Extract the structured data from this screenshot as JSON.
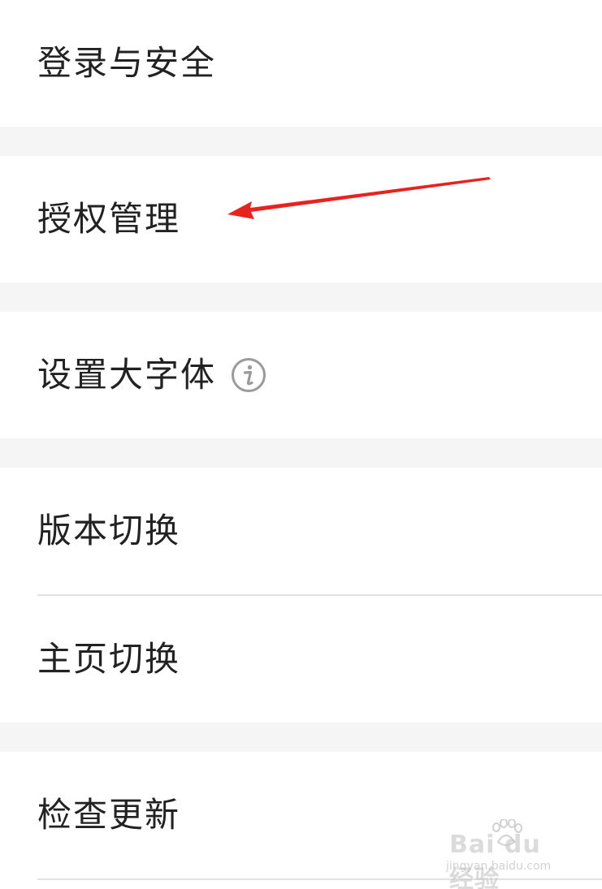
{
  "settings": {
    "items": [
      {
        "label": "登录与安全"
      },
      {
        "label": "授权管理"
      },
      {
        "label": "设置大字体"
      },
      {
        "label": "版本切换"
      },
      {
        "label": "主页切换"
      },
      {
        "label": "检查更新"
      }
    ]
  },
  "icons": {
    "info": "info-icon",
    "annotation": "red-arrow-icon"
  },
  "colors": {
    "background": "#f5f5f5",
    "row": "#ffffff",
    "text": "#222222",
    "divider": "#e2e2e2",
    "arrow": "#e8231f",
    "info_icon": "#9a9a9a"
  },
  "watermark": {
    "brand": "Bai du 经验",
    "url": "jingyan.baidu.com"
  }
}
